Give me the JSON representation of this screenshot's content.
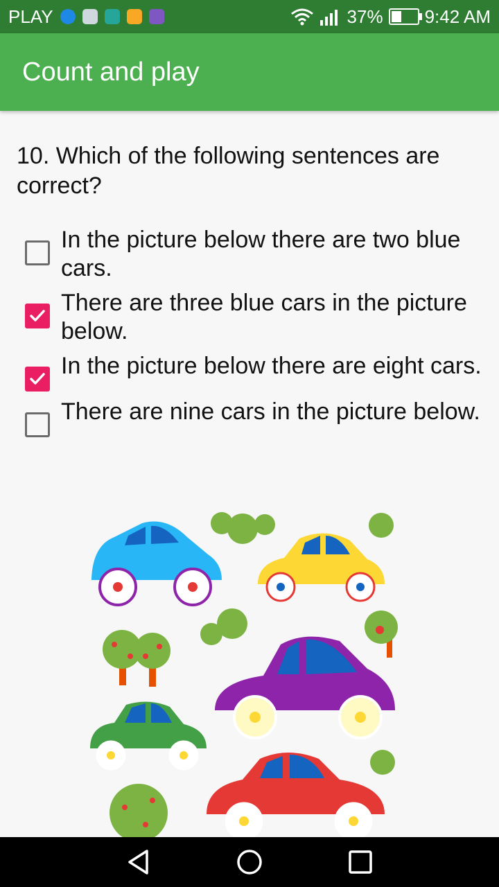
{
  "status_bar": {
    "carrier": "PLAY",
    "battery_percent": "37%",
    "time": "9:42 AM",
    "notification_icons": [
      "globe-icon",
      "mail-icon",
      "android-icon",
      "lock-icon",
      "gallery-icon"
    ]
  },
  "app_bar": {
    "title": "Count and play"
  },
  "question": {
    "text": "10. Which of the following sentences are correct?",
    "options": [
      {
        "label": "In the picture below there are two blue cars.",
        "checked": false
      },
      {
        "label": "There are three blue cars in the picture below.",
        "checked": true
      },
      {
        "label": "In the picture below there are eight cars.",
        "checked": true
      },
      {
        "label": "There are nine cars in the picture below.",
        "checked": false
      }
    ]
  },
  "colors": {
    "app_bar": "#4caf50",
    "status_bar": "#2e7d32",
    "checkbox_checked": "#e91e63"
  },
  "illustration": {
    "name": "cars-and-trees-picture"
  }
}
